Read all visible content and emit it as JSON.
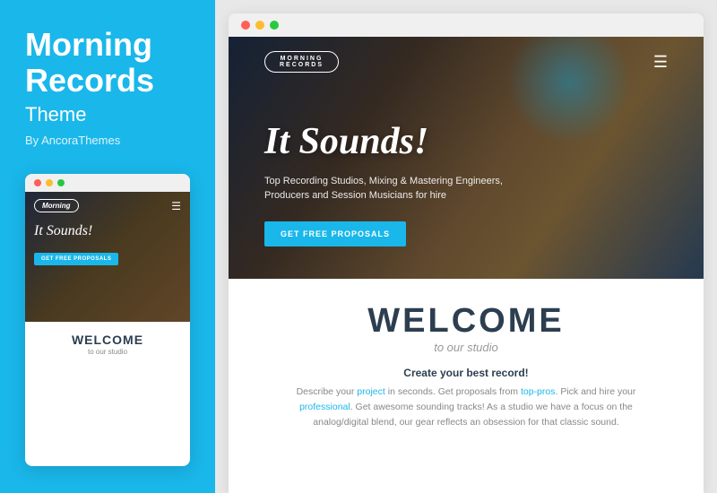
{
  "left": {
    "title_line1": "Morning",
    "title_line2": "Records",
    "subtitle": "Theme",
    "by": "By AncoraThemes",
    "mini_logo": "Morning",
    "mini_hero_title": "It Sounds!",
    "mini_cta": "GET FREE PROPOSALS",
    "mini_welcome_title": "WELCOME",
    "mini_welcome_sub": "to our studio"
  },
  "right": {
    "hero_logo_top": "Morning",
    "hero_logo_sub": "RECORDS",
    "hero_title": "It Sounds!",
    "hero_desc": "Top Recording Studios, Mixing & Mastering Engineers, Producers and Session Musicians for hire",
    "hero_cta": "GET FREE PROPOSALS",
    "welcome_title": "WELCOME",
    "welcome_subtitle": "to our studio",
    "welcome_create": "Create your best record!",
    "welcome_body_1": "Describe your ",
    "welcome_link1": "project",
    "welcome_body_2": " in seconds. Get proposals from ",
    "welcome_link2": "top-pros",
    "welcome_body_3": ". Pick and hire your ",
    "welcome_link3": "professional",
    "welcome_body_4": ". Get awesome sounding tracks! As a studio we have a focus on the analog/digital blend, our gear reflects an obsession for that classic sound."
  },
  "dots": {
    "red": "#ff5f57",
    "yellow": "#febc2e",
    "green": "#28c840"
  }
}
